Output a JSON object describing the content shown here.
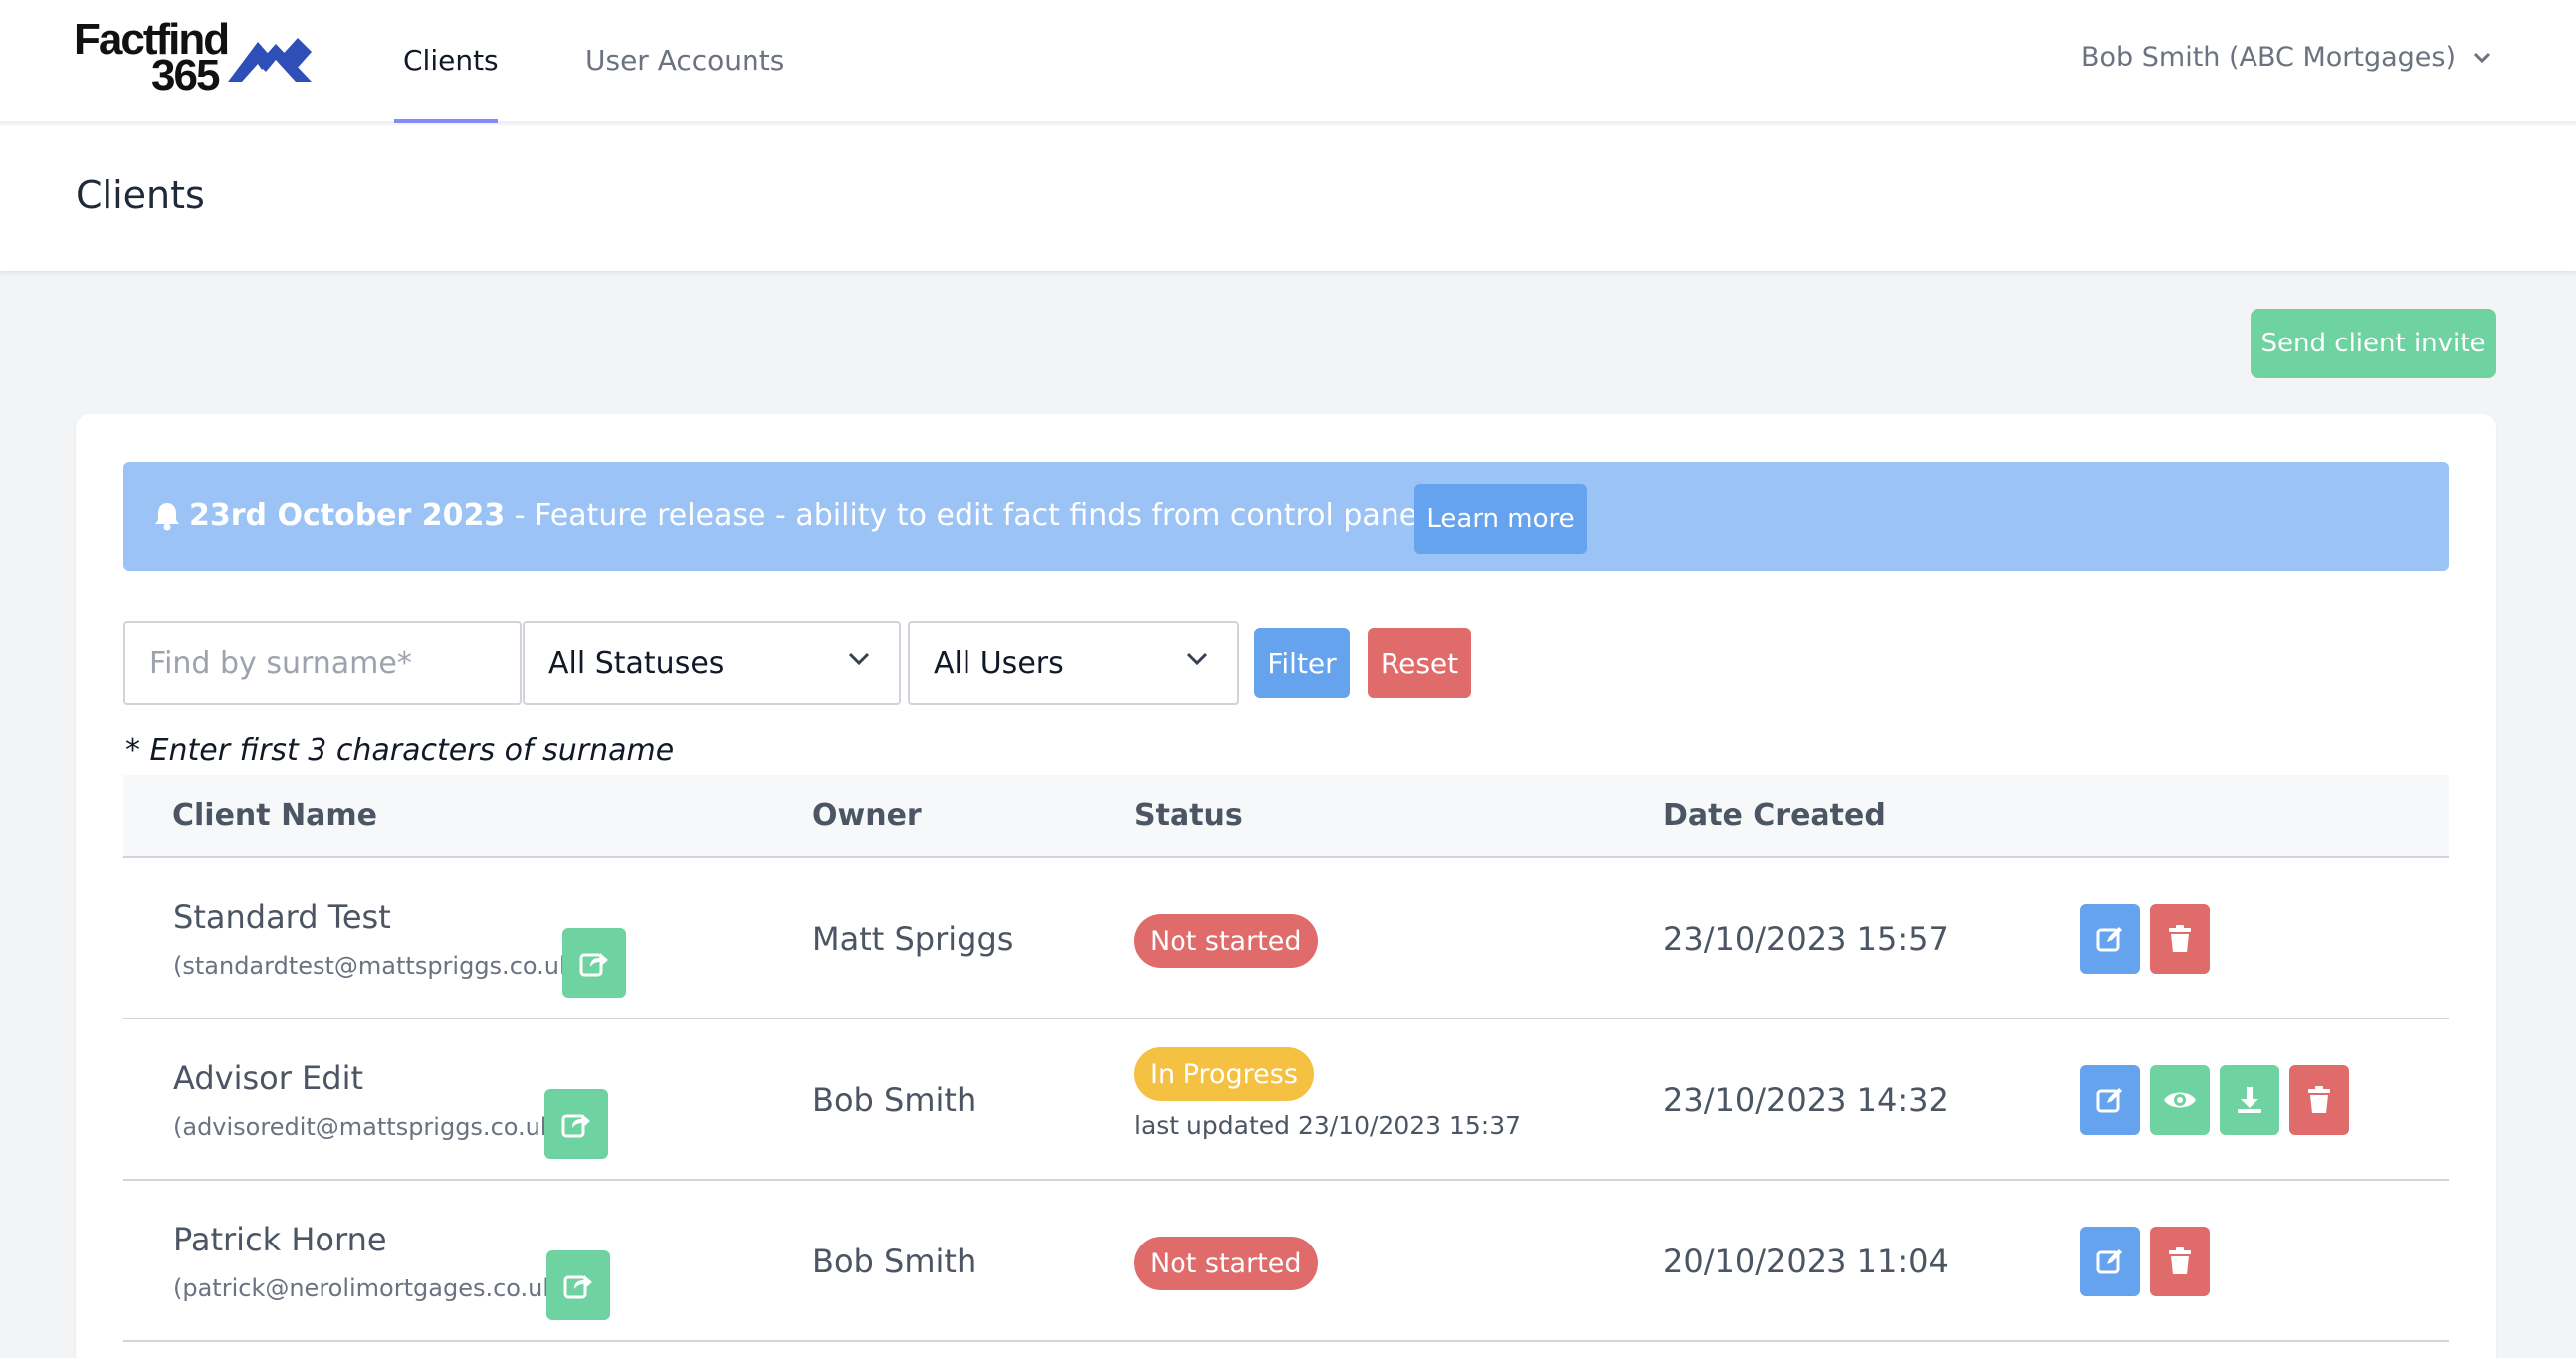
{
  "nav": {
    "logo_line1": "Factfind",
    "logo_line2": "365",
    "tabs": [
      "Clients",
      "User Accounts"
    ],
    "user_menu": "Bob Smith (ABC Mortgages)"
  },
  "page": {
    "title": "Clients"
  },
  "actions": {
    "send_invite": "Send client invite"
  },
  "banner": {
    "date": "23rd October 2023",
    "message": " - Feature release - ability to edit fact finds from control panel.",
    "learn_more": "Learn more"
  },
  "filters": {
    "search_placeholder": "Find by surname*",
    "status_select": "All Statuses",
    "user_select": "All Users",
    "filter_label": "Filter",
    "reset_label": "Reset",
    "hint": "* Enter first 3 characters of surname"
  },
  "table": {
    "headers": [
      "Client Name",
      "Owner",
      "Status",
      "Date Created"
    ],
    "rows": [
      {
        "name": "Standard Test",
        "email": "(standardtest@mattspriggs.co.uk)",
        "owner": "Matt Spriggs",
        "status": "Not started",
        "updated": "",
        "created": "23/10/2023 15:57"
      },
      {
        "name": "Advisor Edit",
        "email": "(advisoredit@mattspriggs.co.uk)",
        "owner": "Bob Smith",
        "status": "In Progress",
        "updated": "last updated 23/10/2023 15:37",
        "created": "23/10/2023 14:32"
      },
      {
        "name": "Patrick Horne",
        "email": "(patrick@nerolimortgages.co.uk)",
        "owner": "Bob Smith",
        "status": "Not started",
        "updated": "",
        "created": "20/10/2023 11:04"
      }
    ]
  },
  "colors": {
    "accent_blue": "#66a3ee",
    "success_green": "#6ed3a0",
    "danger_red": "#e06b6b",
    "warning_yellow": "#f4c143",
    "banner_blue": "#9bc3f5",
    "tab_indicator": "#818cf8"
  },
  "icons": {
    "share": "share-icon",
    "edit": "edit-icon",
    "view": "eye-icon",
    "download": "download-icon",
    "delete": "trash-icon",
    "bell": "bell-icon",
    "chevron": "chevron-down-icon"
  }
}
